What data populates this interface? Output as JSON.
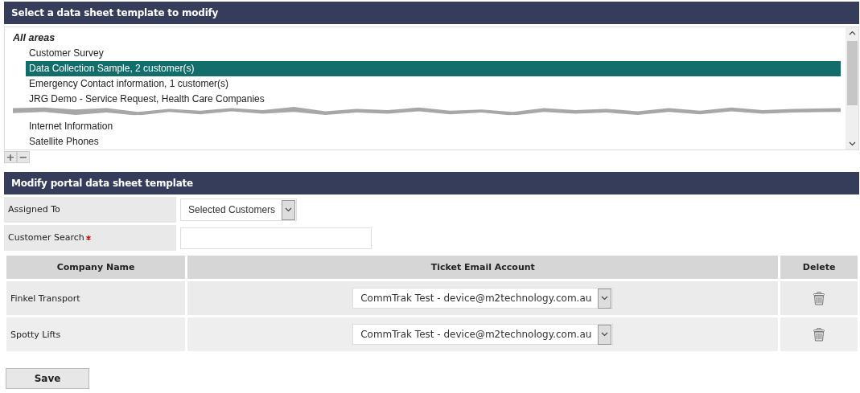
{
  "template_panel": {
    "title": "Select a data sheet template to modify",
    "group": "All areas",
    "segments": [
      {
        "items": [
          {
            "label": "Customer Survey",
            "selected": false
          },
          {
            "label": "Data Collection Sample, 2 customer(s)",
            "selected": true
          },
          {
            "label": "Emergency Contact information, 1 customer(s)",
            "selected": false
          },
          {
            "label": "JRG Demo - Service Request, Health Care Companies",
            "selected": false
          }
        ]
      },
      {
        "items": [
          {
            "label": "Internet Information",
            "selected": false
          },
          {
            "label": "Satellite Phones",
            "selected": false
          }
        ]
      }
    ],
    "add_button": "+",
    "remove_button": "−"
  },
  "modify_panel": {
    "title": "Modify portal data sheet template",
    "fields": [
      {
        "label": "Assigned To",
        "kind": "select",
        "value": "Selected Customers",
        "required": false
      },
      {
        "label": "Customer Search",
        "kind": "text",
        "required": true
      }
    ],
    "table": {
      "columns": [
        "Company Name",
        "Ticket Email Account",
        "Delete"
      ],
      "rows": [
        {
          "company": "Finkel Transport",
          "account": "CommTrak Test - device@m2technology.com.au"
        },
        {
          "company": "Spotty Lifts",
          "account": "CommTrak Test - device@m2technology.com.au"
        }
      ]
    },
    "save_button": "Save"
  }
}
